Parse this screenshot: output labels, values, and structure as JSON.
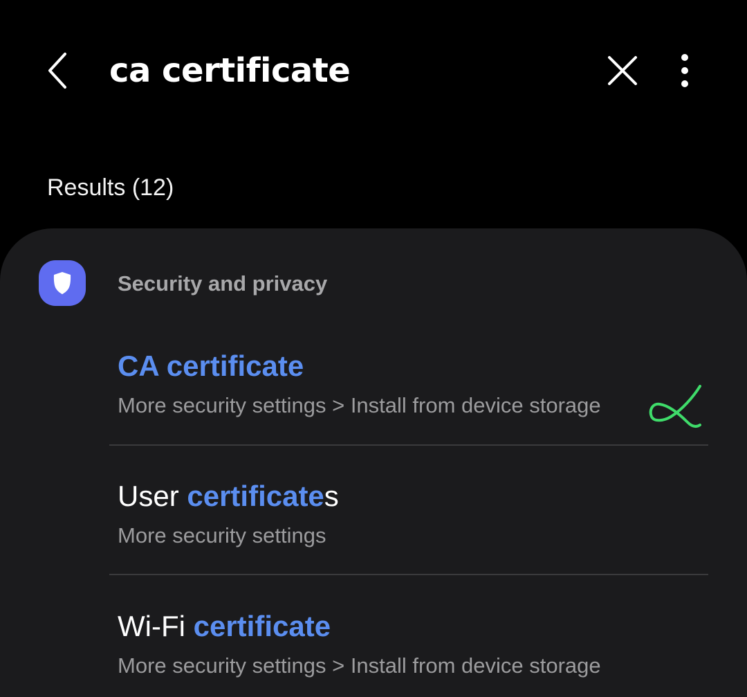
{
  "search": {
    "query": "ca certificate"
  },
  "icons": {
    "back": "chevron-left-icon",
    "clear": "close-icon",
    "more": "more-vertical-icon",
    "category": "shield-icon"
  },
  "colors": {
    "background": "#000000",
    "card": "#1b1b1d",
    "accent": "#5b8ef0",
    "category_icon_bg": "#5f6cf0",
    "annotation": "#3fdc6a"
  },
  "results": {
    "header": "Results (12)",
    "category": "Security and privacy",
    "items": [
      {
        "title_prefix": "",
        "title_highlight": "CA certificate",
        "title_suffix": "",
        "path": "More security settings > Install from device storage"
      },
      {
        "title_prefix": "User ",
        "title_highlight": "certificate",
        "title_suffix": "s",
        "path": "More security settings"
      },
      {
        "title_prefix": "Wi-Fi ",
        "title_highlight": "certificate",
        "title_suffix": "",
        "path": "More security settings > Install from device storage"
      }
    ]
  }
}
